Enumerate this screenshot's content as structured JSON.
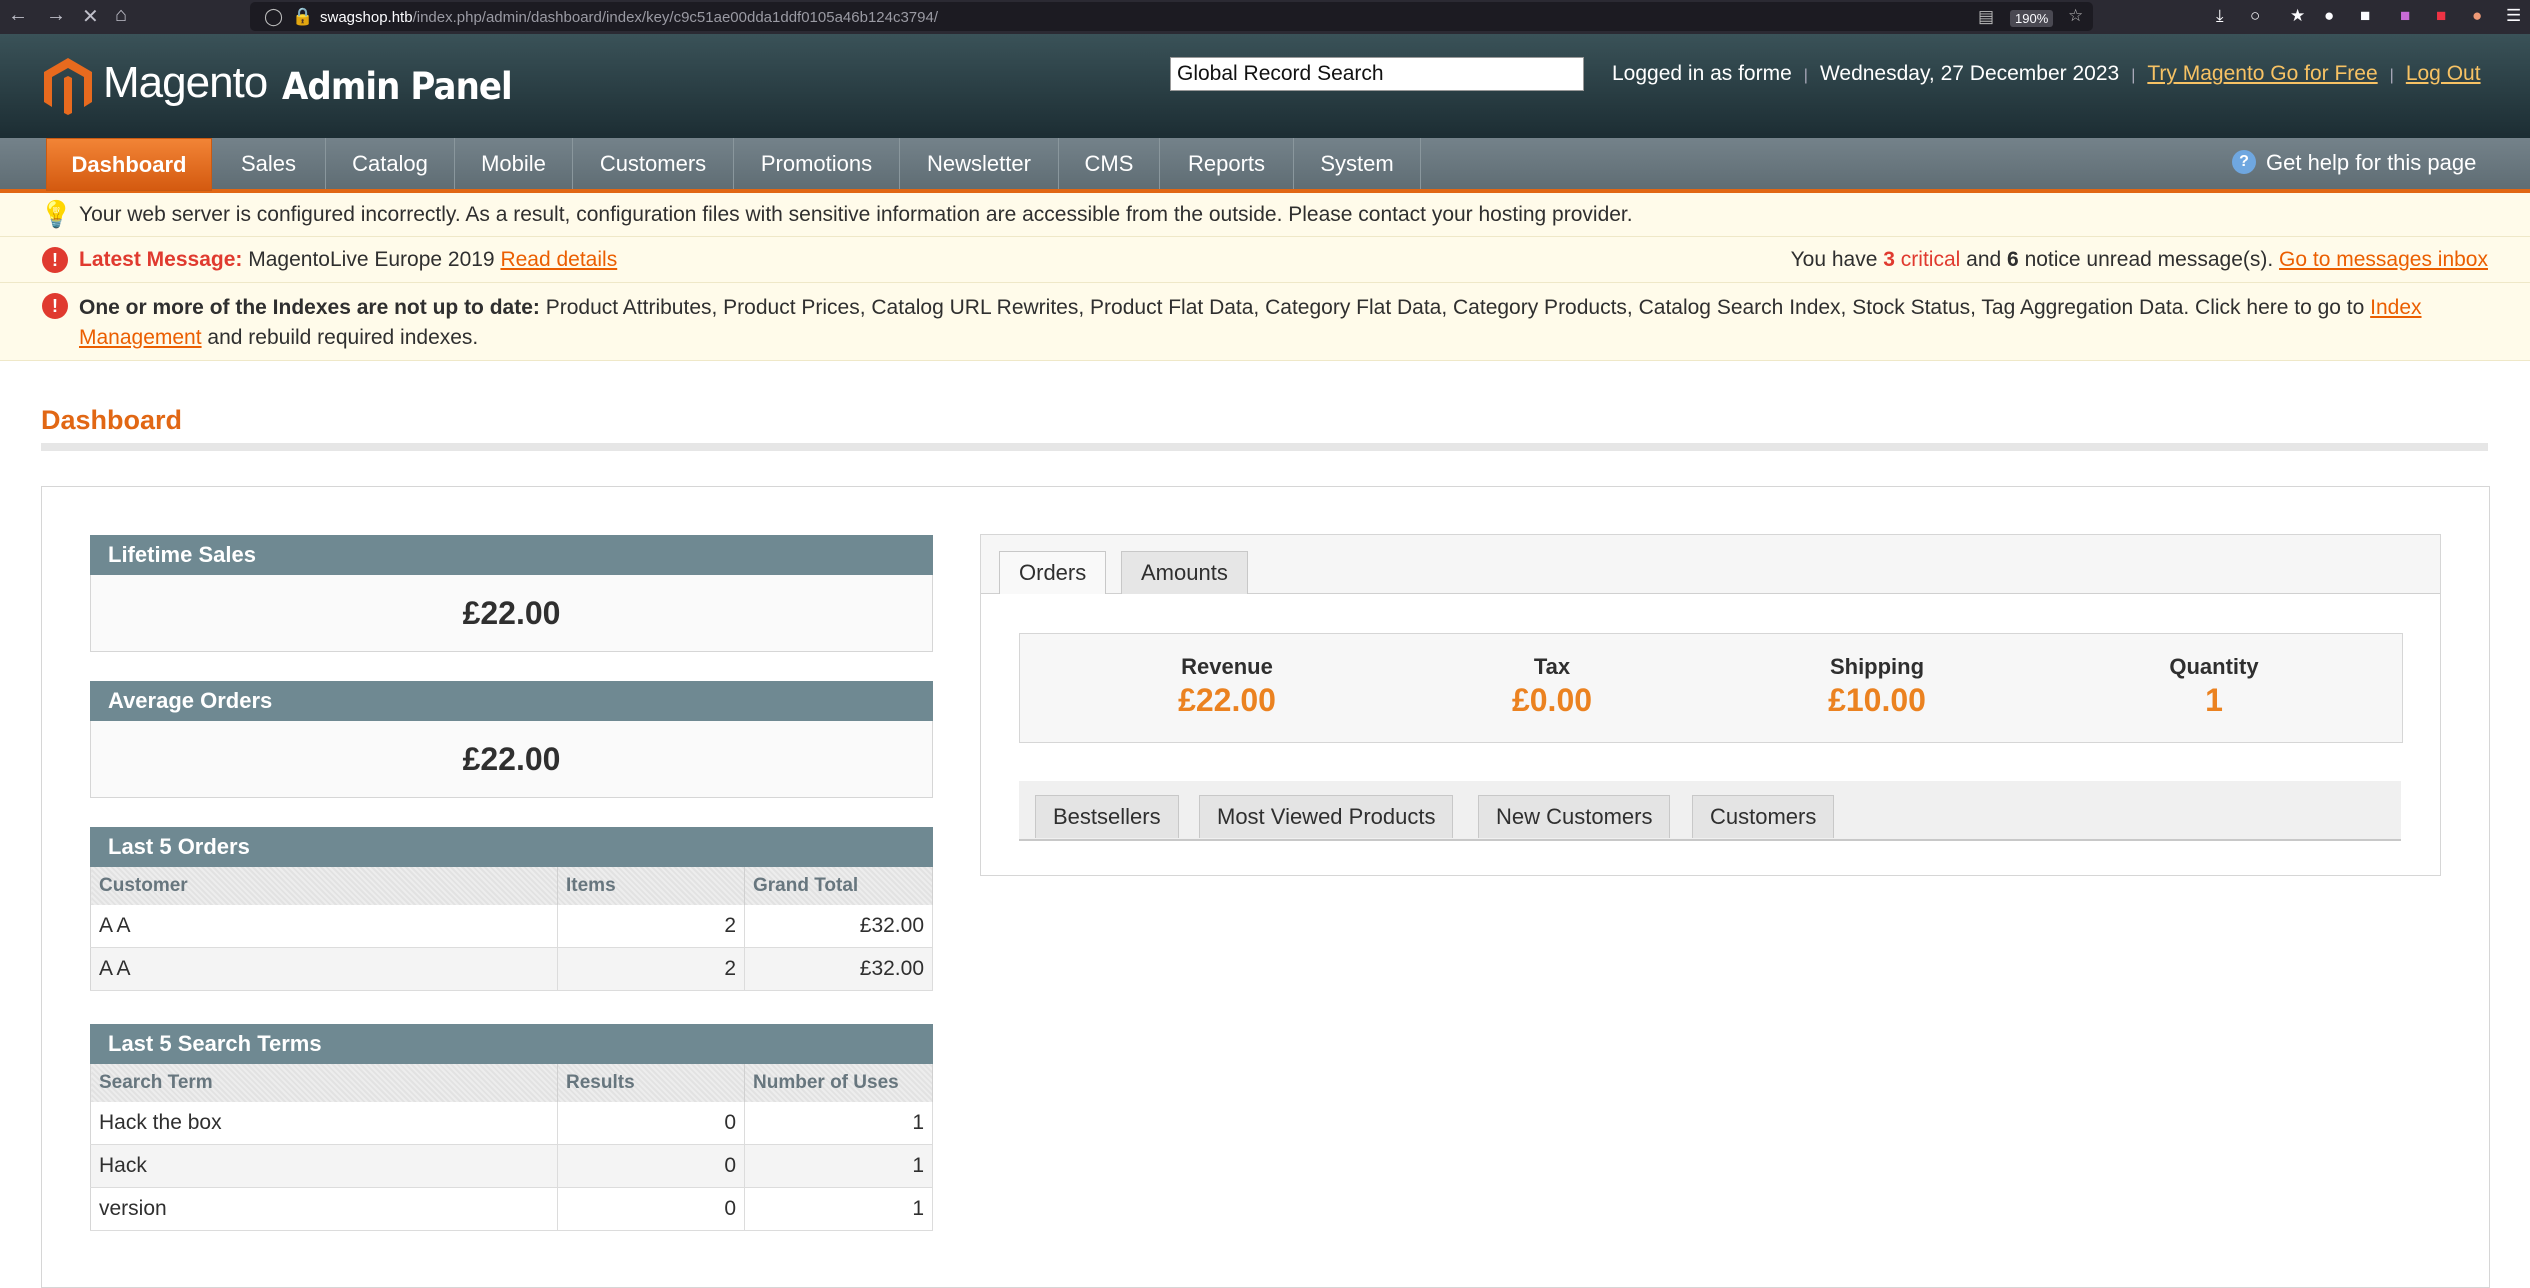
{
  "browser": {
    "url_host": "swagshop.htb",
    "url_path": "/index.php/admin/dashboard/index/key/c9c51ae00dda1ddf0105a46b124c3794/",
    "zoom": "190%"
  },
  "header": {
    "logo_text": "Magento",
    "logo_sub": "Admin Panel",
    "search_value": "Global Record Search",
    "logged_in": "Logged in as forme",
    "date": "Wednesday, 27 December 2023",
    "try_link": "Try Magento Go for Free",
    "logout": "Log Out"
  },
  "nav": {
    "items": [
      "Dashboard",
      "Sales",
      "Catalog",
      "Mobile",
      "Customers",
      "Promotions",
      "Newsletter",
      "CMS",
      "Reports",
      "System"
    ],
    "help": "Get help for this page"
  },
  "notices": {
    "server_warning": "Your web server is configured incorrectly. As a result, configuration files with sensitive information are accessible from the outside. Please contact your hosting provider.",
    "latest_label": "Latest Message:",
    "latest_text": "MagentoLive Europe 2019",
    "read_details": "Read details",
    "unread_pre": "You have",
    "critical_count": "3",
    "critical_word": "critical",
    "and_word": "and",
    "notice_count": "6",
    "unread_post": "notice unread message(s).",
    "inbox_link": "Go to messages inbox",
    "index_label": "One or more of the Indexes are not up to date:",
    "index_text": "Product Attributes, Product Prices, Catalog URL Rewrites, Product Flat Data, Category Flat Data, Category Products, Catalog Search Index, Stock Status, Tag Aggregation Data. Click here to go to",
    "index_link": "Index Management",
    "index_post": "and rebuild required indexes."
  },
  "page": {
    "title": "Dashboard"
  },
  "lifetime_sales": {
    "title": "Lifetime Sales",
    "value": "£22.00"
  },
  "average_orders": {
    "title": "Average Orders",
    "value": "£22.00"
  },
  "last_orders": {
    "title": "Last 5 Orders",
    "headers": [
      "Customer",
      "Items",
      "Grand Total"
    ],
    "rows": [
      [
        "A A",
        "2",
        "£32.00"
      ],
      [
        "A A",
        "2",
        "£32.00"
      ]
    ]
  },
  "last_search": {
    "title": "Last 5 Search Terms",
    "headers": [
      "Search Term",
      "Results",
      "Number of Uses"
    ],
    "rows": [
      [
        "Hack the box",
        "0",
        "1"
      ],
      [
        "Hack",
        "0",
        "1"
      ],
      [
        "version",
        "0",
        "1"
      ]
    ]
  },
  "tabs": {
    "orders": "Orders",
    "amounts": "Amounts"
  },
  "totals": [
    {
      "label": "Revenue",
      "value": "£22.00"
    },
    {
      "label": "Tax",
      "value": "£0.00"
    },
    {
      "label": "Shipping",
      "value": "£10.00"
    },
    {
      "label": "Quantity",
      "value": "1"
    }
  ],
  "subtabs": [
    "Bestsellers",
    "Most Viewed Products",
    "New Customers",
    "Customers"
  ],
  "colors": {
    "accent": "#e16714",
    "box_header": "#6f8992",
    "value_orange": "#eb8220"
  }
}
